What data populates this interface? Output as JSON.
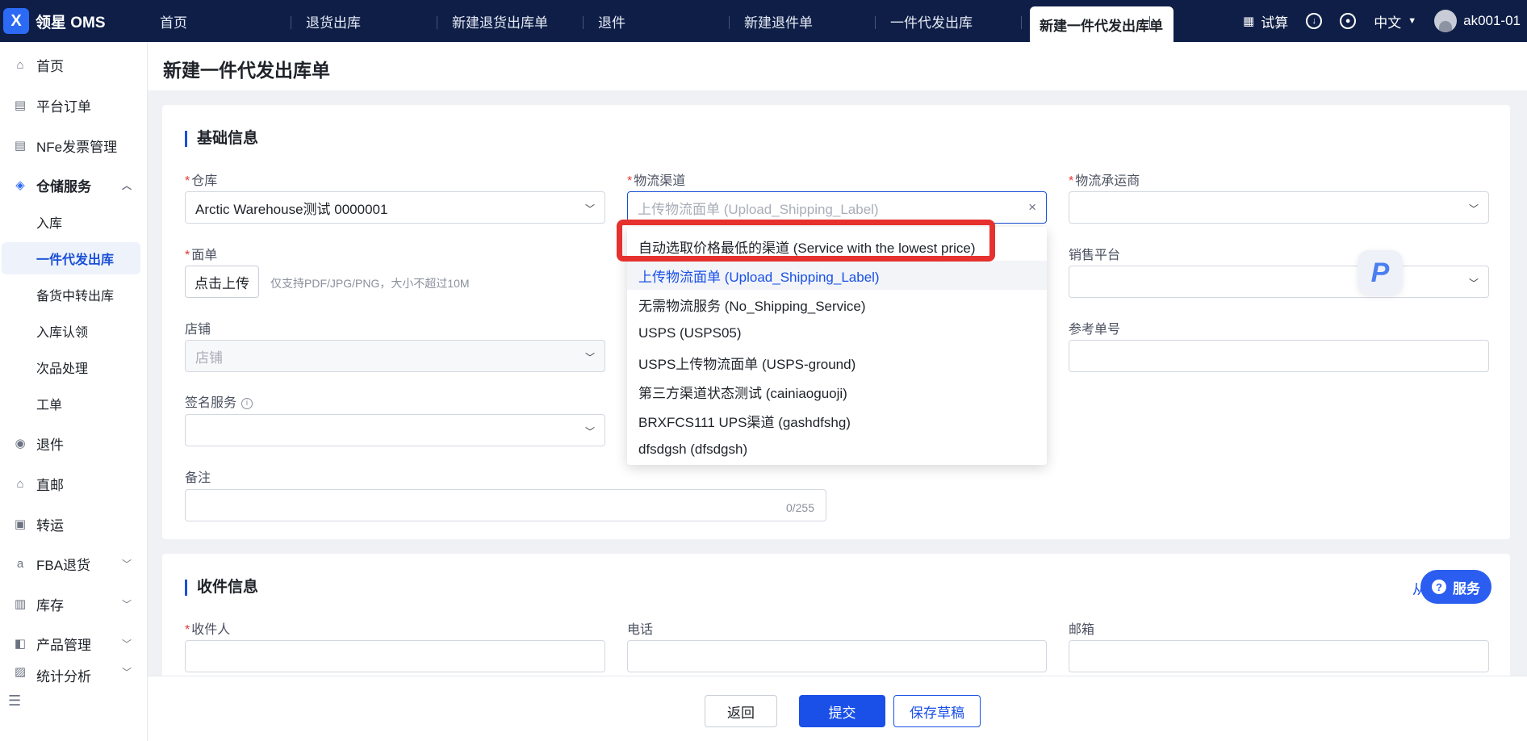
{
  "app": {
    "title": "领星 OMS",
    "logo_char": "X"
  },
  "tabs": [
    {
      "label": "首页"
    },
    {
      "label": "退货出库"
    },
    {
      "label": "新建退货出库单"
    },
    {
      "label": "退件"
    },
    {
      "label": "新建退件单"
    },
    {
      "label": "一件代发出库"
    },
    {
      "label": "新建一件代发出库单",
      "active": true
    }
  ],
  "tabs_more": "···",
  "top_right": {
    "trial": "试算",
    "language": "中文",
    "user": "ak001-01"
  },
  "sidebar": {
    "items": [
      {
        "label": "首页",
        "icon": "home-icon"
      },
      {
        "label": "平台订单",
        "icon": "clipboard-icon"
      },
      {
        "label": "NFe发票管理",
        "icon": "clipboard-icon"
      },
      {
        "label": "仓储服务",
        "icon": "warehouse-icon",
        "expanded": true
      },
      {
        "label": "退件",
        "icon": "return-icon"
      },
      {
        "label": "直邮",
        "icon": "mail-icon"
      },
      {
        "label": "转运",
        "icon": "transfer-icon"
      },
      {
        "label": "FBA退货",
        "icon": "amazon-icon"
      },
      {
        "label": "库存",
        "icon": "inventory-icon"
      },
      {
        "label": "产品管理",
        "icon": "product-icon"
      },
      {
        "label": "统计分析",
        "icon": "stats-icon"
      }
    ],
    "sub_items": [
      {
        "label": "入库"
      },
      {
        "label": "一件代发出库",
        "active": true
      },
      {
        "label": "备货中转出库"
      },
      {
        "label": "入库认领"
      },
      {
        "label": "次品处理"
      },
      {
        "label": "工单"
      }
    ]
  },
  "page": {
    "title": "新建一件代发出库单"
  },
  "basic_info": {
    "section_title": "基础信息",
    "warehouse": {
      "label": "仓库",
      "value": "Arctic Warehouse测试 0000001"
    },
    "channel": {
      "label": "物流渠道",
      "value": "上传物流面单 (Upload_Shipping_Label)"
    },
    "carrier": {
      "label": "物流承运商",
      "value": ""
    },
    "waybill": {
      "label": "面单",
      "upload_label": "点击上传",
      "hint": "仅支持PDF/JPG/PNG，大小不超过10M"
    },
    "platform": {
      "label": "销售平台",
      "value": ""
    },
    "shop": {
      "label": "店铺",
      "placeholder": "店铺"
    },
    "reference": {
      "label": "参考单号",
      "value": ""
    },
    "signature": {
      "label": "签名服务",
      "value": ""
    },
    "remark": {
      "label": "备注",
      "counter": "0/255"
    }
  },
  "channel_options": [
    {
      "label": "自动选取价格最低的渠道 (Service with the lowest price)",
      "highlighted": true
    },
    {
      "label": "上传物流面单 (Upload_Shipping_Label)",
      "selected": true
    },
    {
      "label": "无需物流服务 (No_Shipping_Service)"
    },
    {
      "label": "USPS (USPS05)"
    },
    {
      "label": "USPS上传物流面单 (USPS-ground)"
    },
    {
      "label": "第三方渠道状态测试 (cainiaoguoji)"
    },
    {
      "label": "BRXFCS111 UPS渠道 (gashdfshg)"
    },
    {
      "label": "dfsdgsh (dfsdgsh)"
    }
  ],
  "recipient_info": {
    "section_title": "收件信息",
    "link": "从",
    "recipient": {
      "label": "收件人",
      "value": ""
    },
    "phone": {
      "label": "电话",
      "value": ""
    },
    "email": {
      "label": "邮箱",
      "value": ""
    }
  },
  "footer": {
    "back": "返回",
    "submit": "提交",
    "save_draft": "保存草稿"
  },
  "floating": {
    "p_badge": "P",
    "service": "服务",
    "service_icon": "?"
  },
  "colors": {
    "topbar": "#0e1e47",
    "accent": "#1a50e8",
    "highlight": "#e6312e"
  }
}
